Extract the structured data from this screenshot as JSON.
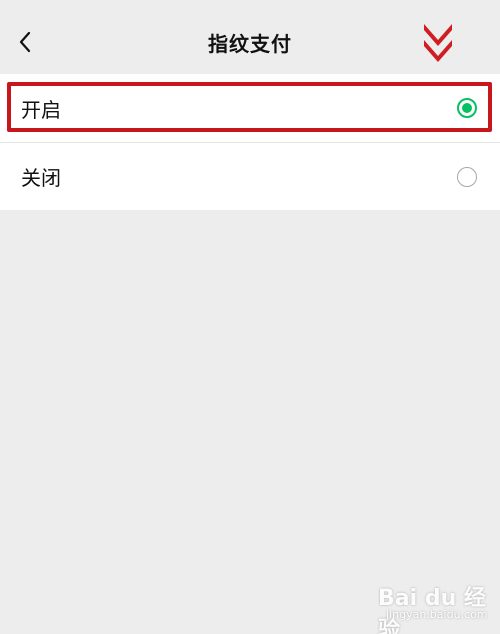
{
  "navbar": {
    "title": "指纹支付",
    "back_icon": "chevron-left-icon"
  },
  "annotation": {
    "arrow_icon": "double-down-arrow-icon",
    "highlight_color": "#c8161d"
  },
  "options": [
    {
      "label": "开启",
      "selected": true
    },
    {
      "label": "关闭",
      "selected": false
    }
  ],
  "accent_color": "#07c160",
  "watermark": {
    "main": "Bai du 经验",
    "sub": "jingyan.baidu.com"
  }
}
